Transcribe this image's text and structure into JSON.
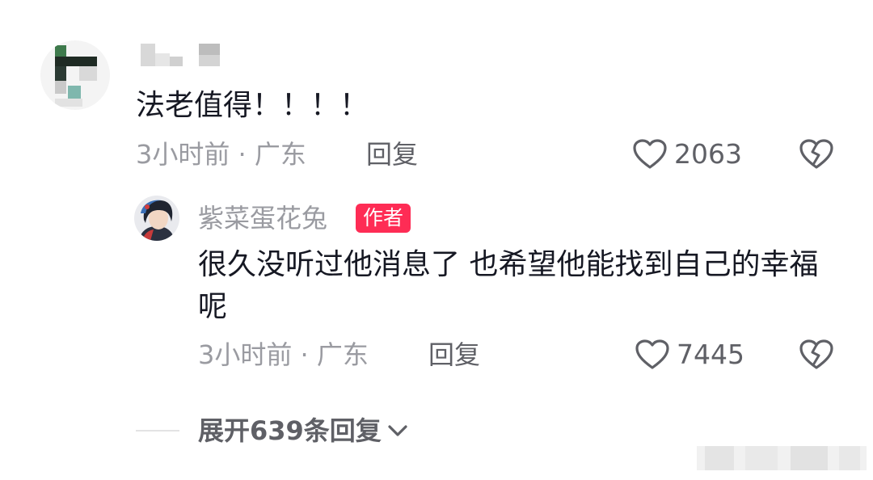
{
  "comment": {
    "text": "法老值得！！！！",
    "time_location": "3小时前 · 广东",
    "reply_label": "回复",
    "like_count": "2063"
  },
  "reply": {
    "username": "紫菜蛋花兔",
    "author_badge": "作者",
    "text": "很久没听过他消息了 也希望他能找到自己的幸福呢",
    "time_location": "3小时前 · 广东",
    "reply_label": "回复",
    "like_count": "7445"
  },
  "expand": {
    "label": "展开639条回复"
  },
  "icons": {
    "like": "heart-outline-icon",
    "dislike": "broken-heart-icon",
    "expand": "chevron-down-icon"
  },
  "colors": {
    "badge": "#fe2c55",
    "meta_text": "#9a9ba1",
    "action_text": "#5f6066",
    "body_text": "#161823"
  }
}
